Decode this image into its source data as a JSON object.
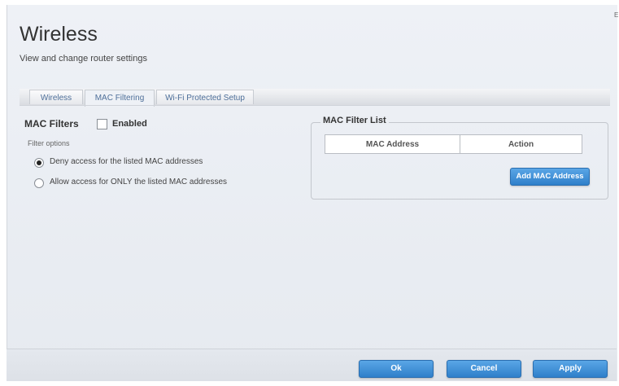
{
  "page": {
    "title": "Wireless",
    "subtitle": "View and change router settings"
  },
  "tabs": [
    {
      "label": "Wireless",
      "active": false
    },
    {
      "label": "MAC Filtering",
      "active": true
    },
    {
      "label": "Wi-Fi Protected Setup",
      "active": false
    }
  ],
  "mac_filters": {
    "label": "MAC Filters",
    "enabled_label": "Enabled",
    "enabled_checked": false,
    "options_label": "Filter options",
    "options": [
      {
        "label": "Deny access for the listed MAC addresses",
        "selected": true
      },
      {
        "label": "Allow access for ONLY the listed MAC addresses",
        "selected": false
      }
    ]
  },
  "filter_list": {
    "legend": "MAC Filter List",
    "columns": [
      "MAC Address",
      "Action"
    ],
    "rows": [],
    "add_button": "Add MAC Address"
  },
  "footer": {
    "ok": "Ok",
    "cancel": "Cancel",
    "apply": "Apply"
  },
  "colors": {
    "accent": "#3b8fd9",
    "tab_text": "#4e6f99",
    "background": "#eef1f6"
  }
}
